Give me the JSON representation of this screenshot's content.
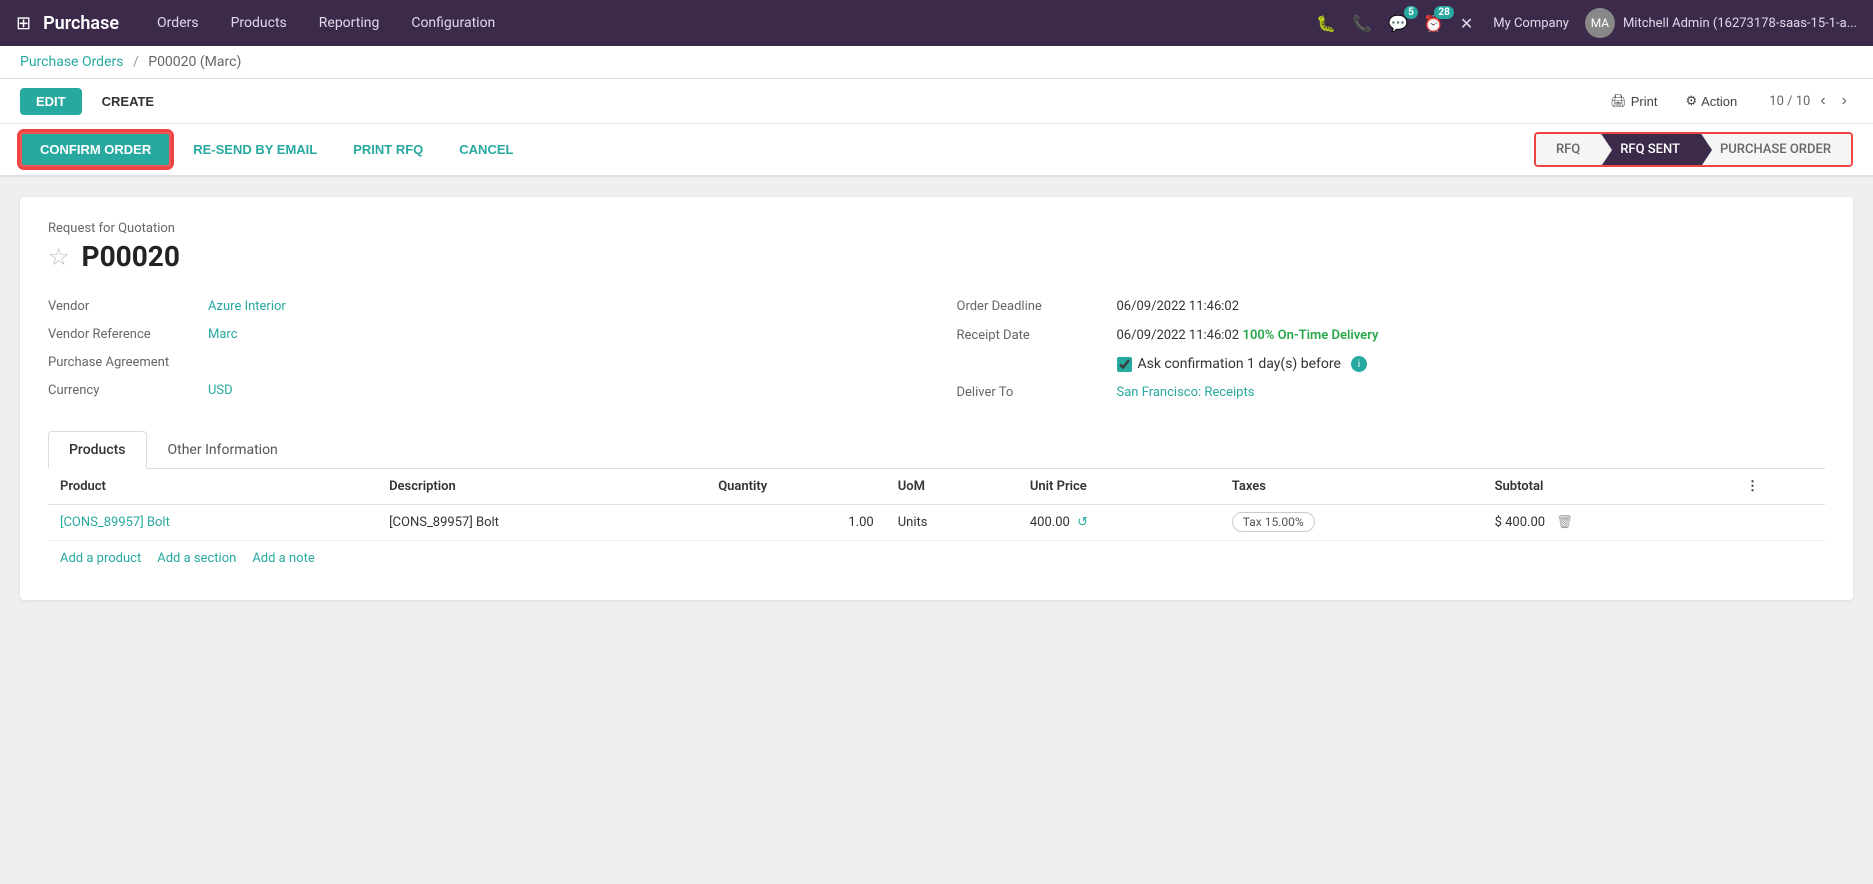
{
  "app": {
    "name": "Purchase",
    "grid_icon": "⊞"
  },
  "topnav": {
    "menu_items": [
      "Orders",
      "Products",
      "Reporting",
      "Configuration"
    ],
    "company": "My Company",
    "username": "Mitchell Admin (16273178-saas-15-1-a...",
    "badge_chat": "5",
    "badge_activity": "28"
  },
  "breadcrumb": {
    "parent": "Purchase Orders",
    "separator": "/",
    "current": "P00020 (Marc)"
  },
  "action_bar": {
    "edit_label": "EDIT",
    "create_label": "CREATE",
    "print_label": "Print",
    "action_label": "Action",
    "page_current": "10",
    "page_total": "10"
  },
  "status_bar": {
    "confirm_label": "CONFIRM ORDER",
    "resend_label": "RE-SEND BY EMAIL",
    "print_rfq_label": "PRINT RFQ",
    "cancel_label": "CANCEL",
    "pipeline_steps": [
      {
        "label": "RFQ",
        "active": false
      },
      {
        "label": "RFQ SENT",
        "active": true
      },
      {
        "label": "PURCHASE ORDER",
        "active": false
      }
    ]
  },
  "form": {
    "section_label": "Request for Quotation",
    "title": "P00020",
    "star_icon": "☆",
    "left_fields": [
      {
        "label": "Vendor",
        "value": "Azure Interior",
        "style": "link"
      },
      {
        "label": "Vendor Reference",
        "value": "Marc",
        "style": "link"
      },
      {
        "label": "Purchase Agreement",
        "value": "",
        "style": "muted"
      },
      {
        "label": "Currency",
        "value": "USD",
        "style": "link"
      }
    ],
    "right_fields": [
      {
        "label": "Order Deadline",
        "value": "06/09/2022 11:46:02",
        "style": "plain"
      },
      {
        "label": "Receipt Date",
        "value": "06/09/2022 11:46:02",
        "style": "plain",
        "extra": "100% On-Time Delivery",
        "extra_style": "green"
      },
      {
        "label": "",
        "value": "",
        "style": "checkbox",
        "checkbox_label": "Ask confirmation 1 day(s) before"
      },
      {
        "label": "Deliver To",
        "value": "San Francisco: Receipts",
        "style": "link"
      }
    ]
  },
  "tabs": [
    {
      "label": "Products",
      "active": true
    },
    {
      "label": "Other Information",
      "active": false
    }
  ],
  "table": {
    "headers": [
      "Product",
      "Description",
      "Quantity",
      "UoM",
      "Unit Price",
      "Taxes",
      "Subtotal",
      ""
    ],
    "rows": [
      {
        "product": "[CONS_89957] Bolt",
        "description": "[CONS_89957] Bolt",
        "quantity": "1.00",
        "uom": "Units",
        "unit_price": "400.00",
        "taxes": "Tax 15.00%",
        "subtotal": "$ 400.00"
      }
    ],
    "add_links": [
      "Add a product",
      "Add a section",
      "Add a note"
    ]
  }
}
